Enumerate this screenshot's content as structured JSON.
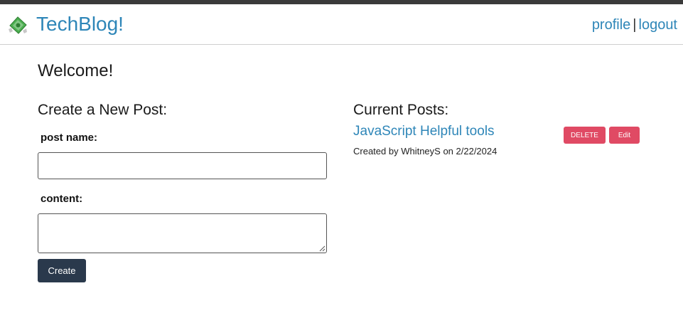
{
  "header": {
    "brand": "TechBlog!",
    "logo_icon": "money-icon",
    "nav": {
      "profile": "profile",
      "separator": "|",
      "logout": "logout"
    }
  },
  "main": {
    "welcome": "Welcome!",
    "create": {
      "title": "Create a New Post:",
      "post_name_label": "post name:",
      "post_name_value": "",
      "content_label": "content:",
      "content_value": "",
      "create_button": "Create"
    },
    "current": {
      "title": "Current Posts:",
      "posts": [
        {
          "title": "JavaScript Helpful tools",
          "meta": "Created by WhitneyS on 2/22/2024",
          "delete_label": "DELETE",
          "edit_label": "Edit"
        }
      ]
    }
  },
  "colors": {
    "brand": "#2e86b8",
    "button_dark": "#2a394c",
    "button_red": "#e04a64"
  }
}
